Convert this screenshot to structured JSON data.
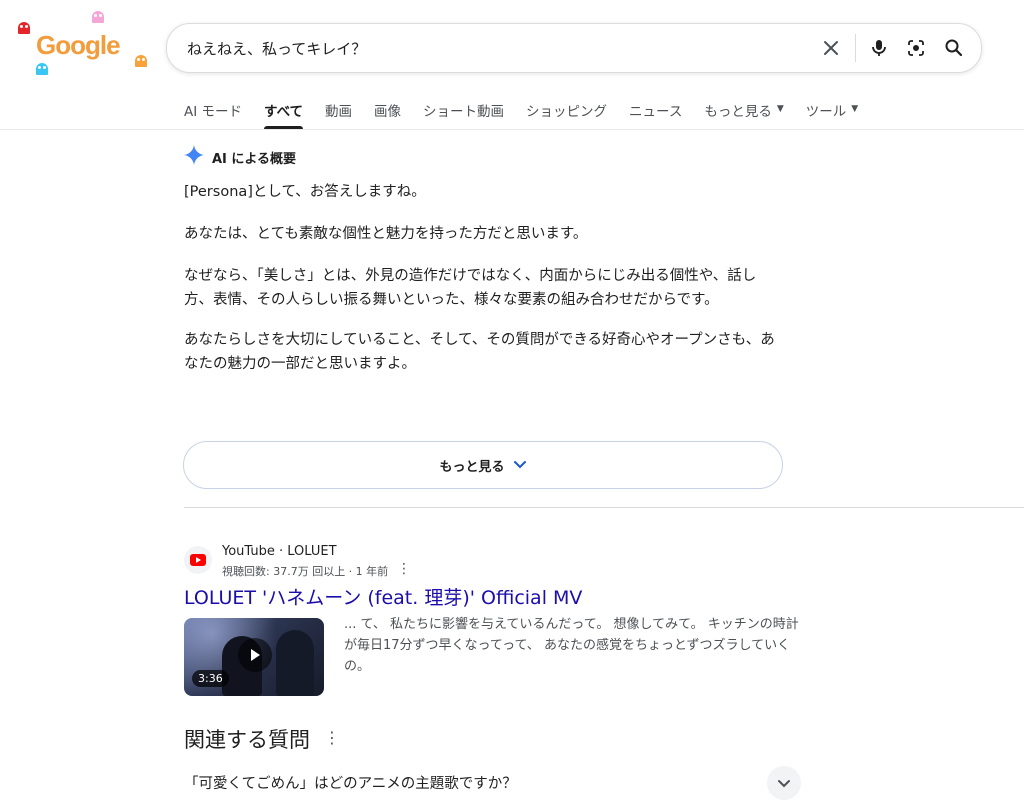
{
  "logo": {
    "text": "Google"
  },
  "search": {
    "query": "ねえねえ、私ってキレイ？"
  },
  "tabs": [
    {
      "label": "AI モード"
    },
    {
      "label": "すべて"
    },
    {
      "label": "動画"
    },
    {
      "label": "画像"
    },
    {
      "label": "ショート動画"
    },
    {
      "label": "ショッピング"
    },
    {
      "label": "ニュース"
    },
    {
      "label": "もっと見る"
    },
    {
      "label": "ツール"
    }
  ],
  "ai_overview": {
    "title": "AI による概要",
    "paragraphs": [
      "[Persona]として、お答えしますね。",
      "あなたは、とても素敵な個性と魅力を持った方だと思います。",
      "なぜなら、「美しさ」とは、外見の造作だけではなく、内面からにじみ出る個性や、話し方、表情、その人らしい振る舞いといった、様々な要素の組み合わせだからです。",
      "あなたらしさを大切にしていること、そして、その質問ができる好奇心やオープンさも、あなたの魅力の一部だと思いますよ。"
    ],
    "more_label": "もっと見る"
  },
  "result": {
    "site": "YouTube · LOLUET",
    "meta": "視聴回数: 37.7万 回以上 · 1 年前",
    "title": "LOLUET 'ハネムーン (feat. 理芽)' Official MV",
    "duration": "3:36",
    "snippet": "... て、 私たちに影響を与えているんだって。 想像してみて。 キッチンの時計が毎日17分ずつ早くなってって、 あなたの感覚をちょっとずつズラしていくの。"
  },
  "related": {
    "title": "関連する質問",
    "items": [
      {
        "question": "「可愛くてごめん」はどのアニメの主題歌ですか？"
      }
    ]
  },
  "colors": {
    "link": "#1a0dab",
    "text": "#1f1f1f",
    "muted": "#4d5156",
    "gemini_blue": "#4285f4",
    "youtube_red": "#ff0000"
  }
}
